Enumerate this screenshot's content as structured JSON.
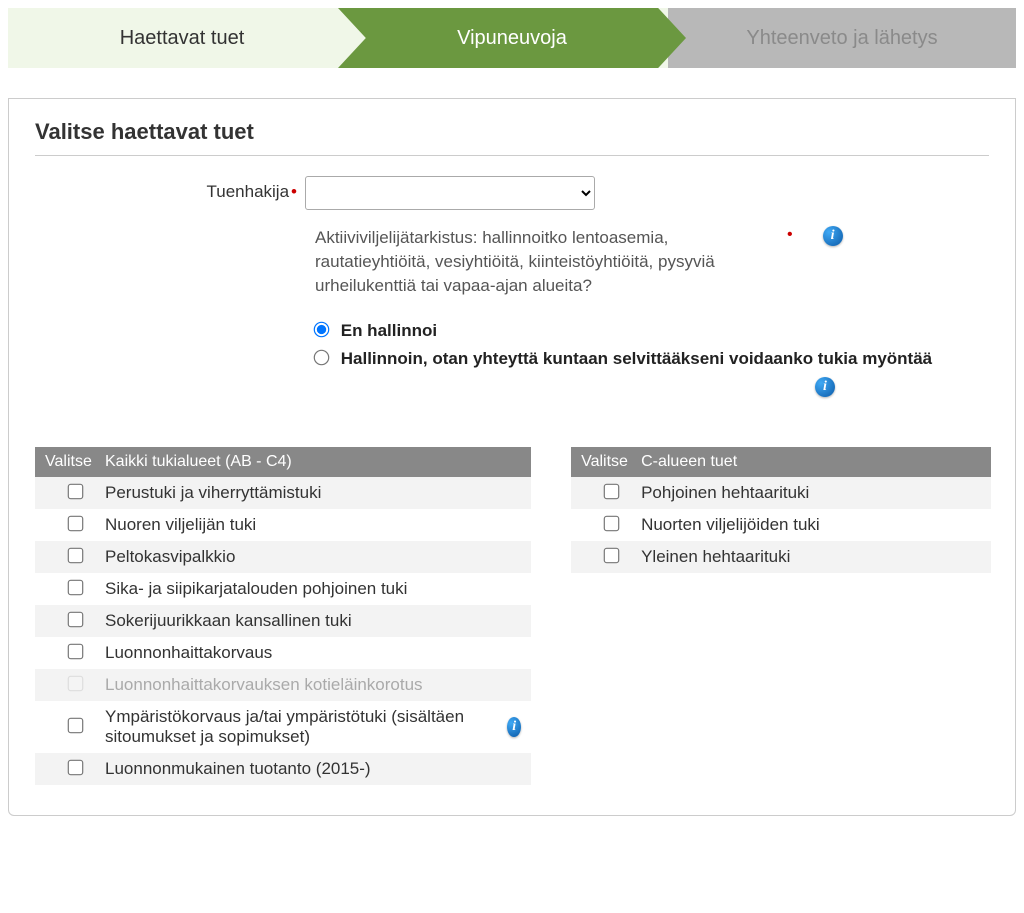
{
  "tabs": {
    "t1": "Haettavat tuet",
    "t2": "Vipuneuvoja",
    "t3": "Yhteenveto ja lähetys"
  },
  "panel": {
    "title": "Valitse haettavat tuet",
    "applicant_label": "Tuenhakija",
    "question": "Aktiiviviljelijätarkistus: hallinnoitko lentoasemia, rautatieyhtiöitä, vesiyhtiöitä, kiinteistöyhtiöitä, pysyviä urheilukenttiä tai vapaa-ajan alueita?",
    "radio1": "En hallinnoi",
    "radio2": "Hallinnoin, otan yhteyttä kuntaan selvittääkseni voidaanko tukia myöntää"
  },
  "left_table": {
    "col_sel": "Valitse",
    "col_name": "Kaikki tukialueet (AB - C4)",
    "rows": {
      "r1": "Perustuki ja viherryttämistuki",
      "r2": "Nuoren viljelijän tuki",
      "r3": "Peltokasvipalkkio",
      "r4": "Sika- ja siipikarjatalouden pohjoinen tuki",
      "r5": "Sokerijuurikkaan kansallinen tuki",
      "r6": "Luonnonhaittakorvaus",
      "r7": "Luonnonhaittakorvauksen kotieläinkorotus",
      "r8": "Ympäristökorvaus ja/tai ympäristötuki (sisältäen sitoumukset ja sopimukset)",
      "r9": "Luonnonmukainen tuotanto (2015-)"
    }
  },
  "right_table": {
    "col_sel": "Valitse",
    "col_name": "C-alueen tuet",
    "rows": {
      "r1": "Pohjoinen hehtaarituki",
      "r2": "Nuorten viljelijöiden tuki",
      "r3": "Yleinen hehtaarituki"
    }
  }
}
